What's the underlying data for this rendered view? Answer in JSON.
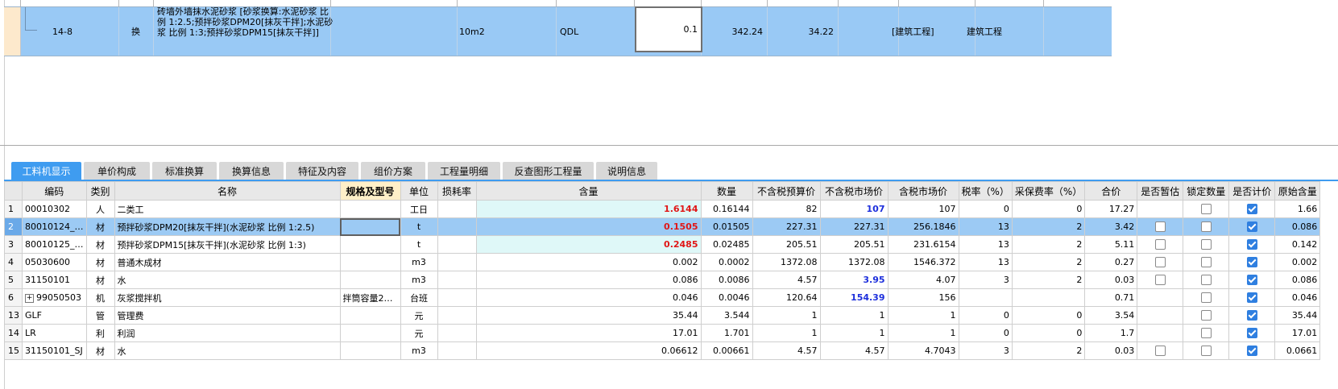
{
  "top_row": {
    "code": "14-8",
    "type": "换",
    "name": "砖墙外墙抹水泥砂浆 [砂浆换算:水泥砂浆 比例 1:2.5;预拌砂浆DPM20[抹灰干拌];水泥砂浆 比例 1:3;预拌砂浆DPM15[抹灰干拌]]",
    "unit": "10m2",
    "qty_expr": "QDL",
    "qty": "0.1",
    "price": "342.24",
    "total": "34.22",
    "professional": "[建筑工程]",
    "category": "建筑工程"
  },
  "tabs": [
    "工料机显示",
    "单价构成",
    "标准换算",
    "换算信息",
    "特征及内容",
    "组价方案",
    "工程量明细",
    "反查图形工程量",
    "说明信息"
  ],
  "columns": [
    "",
    "编码",
    "类别",
    "名称",
    "规格及型号",
    "单位",
    "损耗率",
    "含量",
    "数量",
    "不含税预算价",
    "不含税市场价",
    "含税市场价",
    "税率（%）",
    "采保费率（%）",
    "合价",
    "是否暂估",
    "锁定数量",
    "是否计价",
    "原始含量"
  ],
  "rows": [
    {
      "no": "1",
      "code": "00010302",
      "cat": "人",
      "name": "二类工",
      "spec": "",
      "unit": "工日",
      "loss": "",
      "content": "1.6144",
      "qty": "0.16144",
      "budget": "82",
      "market": "107",
      "market_tax": "107",
      "tax": "0",
      "fee": "0",
      "total": "17.27",
      "est": null,
      "lock": false,
      "priced": true,
      "orig": "1.66"
    },
    {
      "no": "2",
      "code": "80010124_…",
      "cat": "材",
      "name": "预拌砂浆DPM20[抹灰干拌](水泥砂浆 比例 1:2.5)",
      "spec": "",
      "unit": "t",
      "loss": "",
      "content": "0.1505",
      "qty": "0.01505",
      "budget": "227.31",
      "market": "227.31",
      "market_tax": "256.1846",
      "tax": "13",
      "fee": "2",
      "total": "3.42",
      "est": false,
      "lock": false,
      "priced": true,
      "orig": "0.086"
    },
    {
      "no": "3",
      "code": "80010125_…",
      "cat": "材",
      "name": "预拌砂浆DPM15[抹灰干拌](水泥砂浆 比例 1:3)",
      "spec": "",
      "unit": "t",
      "loss": "",
      "content": "0.2485",
      "qty": "0.02485",
      "budget": "205.51",
      "market": "205.51",
      "market_tax": "231.6154",
      "tax": "13",
      "fee": "2",
      "total": "5.11",
      "est": false,
      "lock": false,
      "priced": true,
      "orig": "0.142"
    },
    {
      "no": "4",
      "code": "05030600",
      "cat": "材",
      "name": "普通木成材",
      "spec": "",
      "unit": "m3",
      "loss": "",
      "content": "0.002",
      "qty": "0.0002",
      "budget": "1372.08",
      "market": "1372.08",
      "market_tax": "1546.372",
      "tax": "13",
      "fee": "2",
      "total": "0.27",
      "est": false,
      "lock": false,
      "priced": true,
      "orig": "0.002"
    },
    {
      "no": "5",
      "code": "31150101",
      "cat": "材",
      "name": "水",
      "spec": "",
      "unit": "m3",
      "loss": "",
      "content": "0.086",
      "qty": "0.0086",
      "budget": "4.57",
      "market": "3.95",
      "market_tax": "4.07",
      "tax": "3",
      "fee": "2",
      "total": "0.03",
      "est": false,
      "lock": false,
      "priced": true,
      "orig": "0.086"
    },
    {
      "no": "6",
      "code": "99050503",
      "cat": "机",
      "name": "灰浆搅拌机",
      "spec": "拌筒容量2…",
      "unit": "台班",
      "loss": "",
      "content": "0.046",
      "qty": "0.0046",
      "budget": "120.64",
      "market": "154.39",
      "market_tax": "156",
      "tax": "",
      "fee": "",
      "total": "0.71",
      "est": null,
      "lock": false,
      "priced": true,
      "orig": "0.046"
    },
    {
      "no": "13",
      "code": "GLF",
      "cat": "管",
      "name": "管理费",
      "spec": "",
      "unit": "元",
      "loss": "",
      "content": "35.44",
      "qty": "3.544",
      "budget": "1",
      "market": "1",
      "market_tax": "1",
      "tax": "0",
      "fee": "0",
      "total": "3.54",
      "est": null,
      "lock": false,
      "priced": true,
      "orig": "35.44"
    },
    {
      "no": "14",
      "code": "LR",
      "cat": "利",
      "name": "利润",
      "spec": "",
      "unit": "元",
      "loss": "",
      "content": "17.01",
      "qty": "1.701",
      "budget": "1",
      "market": "1",
      "market_tax": "1",
      "tax": "0",
      "fee": "0",
      "total": "1.7",
      "est": null,
      "lock": false,
      "priced": true,
      "orig": "17.01"
    },
    {
      "no": "15",
      "code": "31150101_SJ",
      "cat": "材",
      "name": "水",
      "spec": "",
      "unit": "m3",
      "loss": "",
      "content": "0.06612",
      "qty": "0.00661",
      "budget": "4.57",
      "market": "4.57",
      "market_tax": "4.7043",
      "tax": "3",
      "fee": "2",
      "total": "0.03",
      "est": false,
      "lock": false,
      "priced": true,
      "orig": "0.0661"
    }
  ],
  "colors": {
    "selected_row": "#9ccaf4",
    "active_tab": "#3f9cf0",
    "content_red": "#e01616",
    "market_blue": "#1d2fdc",
    "content_bg": "#dff8f8"
  }
}
